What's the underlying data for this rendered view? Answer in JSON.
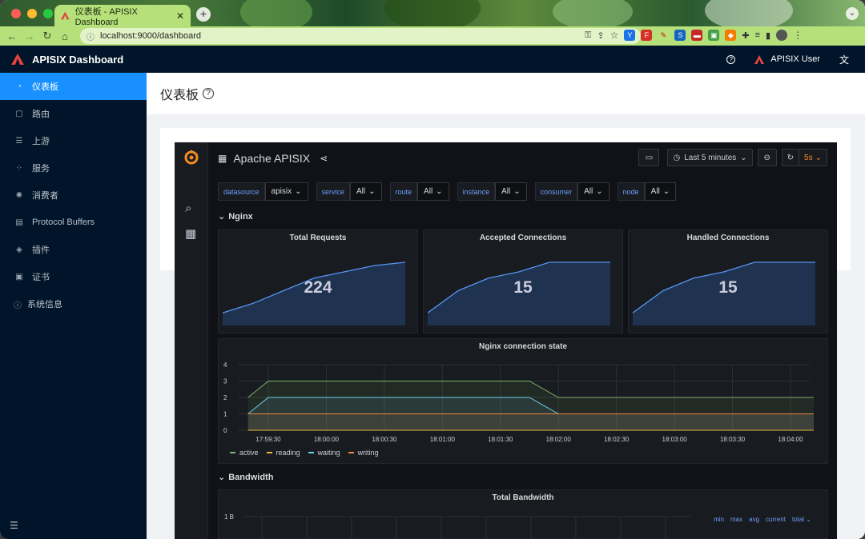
{
  "browser": {
    "tab_title": "仪表板 - APISIX Dashboard",
    "url": "localhost:9000/dashboard",
    "colors": {
      "toolbar": "#b5e07a"
    }
  },
  "header": {
    "brand": "APISIX Dashboard",
    "user": "APISIX User"
  },
  "sidebar": {
    "items": [
      {
        "label": "仪表板",
        "icon": "dashboard-icon"
      },
      {
        "label": "路由",
        "icon": "route-icon"
      },
      {
        "label": "上游",
        "icon": "upstream-icon"
      },
      {
        "label": "服务",
        "icon": "service-icon"
      },
      {
        "label": "消费者",
        "icon": "consumer-icon"
      },
      {
        "label": "Protocol Buffers",
        "icon": "file-icon"
      },
      {
        "label": "插件",
        "icon": "plugin-icon"
      },
      {
        "label": "证书",
        "icon": "certificate-icon"
      },
      {
        "label": "系统信息",
        "icon": "info-icon"
      }
    ],
    "active_index": 0
  },
  "page": {
    "title": "仪表板"
  },
  "grafana": {
    "dashboard_title": "Apache APISIX",
    "time_range": "Last 5 minutes",
    "refresh": "5s",
    "variables": [
      {
        "label": "datasource",
        "value": "apisix"
      },
      {
        "label": "service",
        "value": "All"
      },
      {
        "label": "route",
        "value": "All"
      },
      {
        "label": "instance",
        "value": "All"
      },
      {
        "label": "consumer",
        "value": "All"
      },
      {
        "label": "node",
        "value": "All"
      }
    ],
    "rows": {
      "nginx": "Nginx",
      "bandwidth": "Bandwidth"
    },
    "stats": [
      {
        "title": "Total Requests",
        "value": "224"
      },
      {
        "title": "Accepted Connections",
        "value": "15"
      },
      {
        "title": "Handled Connections",
        "value": "15"
      }
    ],
    "bandwidth_panel": {
      "title": "Total Bandwidth",
      "y_first_label": "1 B",
      "table_headers": [
        "min",
        "max",
        "avg",
        "current",
        "total"
      ]
    }
  },
  "chart_data": [
    {
      "type": "area",
      "title": "Total Requests",
      "x": [
        0,
        1,
        2,
        3,
        4,
        5,
        6
      ],
      "values": [
        0.2,
        0.35,
        0.55,
        0.75,
        0.85,
        0.95,
        1.0
      ],
      "ylim": [
        0,
        1
      ]
    },
    {
      "type": "area",
      "title": "Accepted Connections",
      "x": [
        0,
        1,
        2,
        3,
        4,
        5,
        6
      ],
      "values": [
        0.2,
        0.55,
        0.75,
        0.85,
        1.0,
        1.0,
        1.0
      ],
      "ylim": [
        0,
        1
      ]
    },
    {
      "type": "area",
      "title": "Handled Connections",
      "x": [
        0,
        1,
        2,
        3,
        4,
        5,
        6
      ],
      "values": [
        0.2,
        0.55,
        0.75,
        0.85,
        1.0,
        1.0,
        1.0
      ],
      "ylim": [
        0,
        1
      ]
    },
    {
      "type": "line",
      "title": "Nginx connection state",
      "categories": [
        "17:59:30",
        "18:00:00",
        "18:00:30",
        "18:01:00",
        "18:01:30",
        "18:02:00",
        "18:02:30",
        "18:03:00",
        "18:03:30",
        "18:04:00"
      ],
      "ylim": [
        0,
        4
      ],
      "yticks": [
        0,
        1,
        2,
        3,
        4
      ],
      "grid": true,
      "legend": "bottom-left",
      "series": [
        {
          "name": "active",
          "color": "#7eb26d",
          "x": [
            -0.35,
            0,
            4.5,
            5,
            9.4
          ],
          "values": [
            2,
            3,
            3,
            2,
            2
          ]
        },
        {
          "name": "reading",
          "color": "#eab839",
          "x": [
            -0.35,
            9.4
          ],
          "values": [
            0,
            0
          ]
        },
        {
          "name": "waiting",
          "color": "#6ed0e0",
          "x": [
            -0.35,
            0,
            4.5,
            5,
            9.4
          ],
          "values": [
            1,
            2,
            2,
            1,
            1
          ]
        },
        {
          "name": "writing",
          "color": "#ef843c",
          "x": [
            -0.35,
            9.4
          ],
          "values": [
            1,
            1
          ]
        }
      ]
    }
  ]
}
